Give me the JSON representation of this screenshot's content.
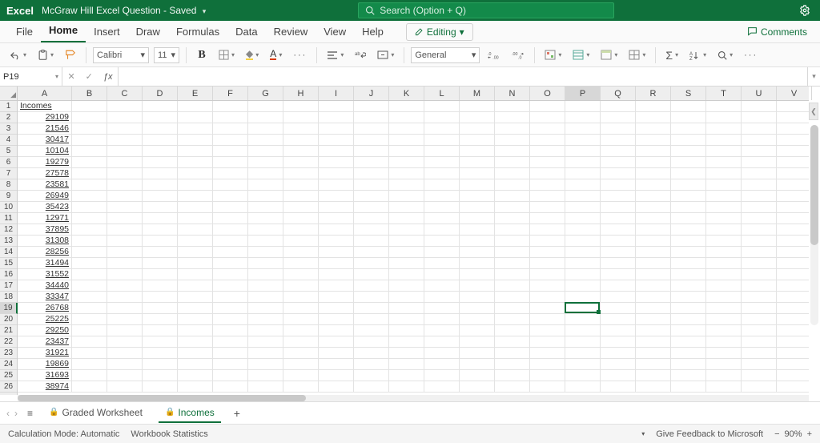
{
  "title": {
    "app": "Excel",
    "doc": "McGraw Hill Excel Question - Saved"
  },
  "search": {
    "placeholder": "Search (Option + Q)"
  },
  "ribbon": {
    "tabs": [
      "File",
      "Home",
      "Insert",
      "Draw",
      "Formulas",
      "Data",
      "Review",
      "View",
      "Help"
    ],
    "active_index": 1,
    "editing_label": "Editing",
    "comments_label": "Comments"
  },
  "toolbar": {
    "font_name": "Calibri",
    "font_size": "11",
    "bold_glyph": "B",
    "number_format": "General",
    "ellipsis": "···"
  },
  "formula_bar": {
    "name_box": "P19",
    "formula": ""
  },
  "columns": [
    "A",
    "B",
    "C",
    "D",
    "E",
    "F",
    "G",
    "H",
    "I",
    "J",
    "K",
    "L",
    "M",
    "N",
    "O",
    "P",
    "Q",
    "R",
    "S",
    "T",
    "U",
    "V"
  ],
  "selected_col_index": 15,
  "row_count": 26,
  "selected_row": 19,
  "colA_header": "Incomes",
  "colA_values": [
    "29109",
    "21546",
    "30417",
    "10104",
    "19279",
    "27578",
    "23581",
    "26949",
    "35423",
    "12971",
    "37895",
    "31308",
    "28256",
    "31494",
    "31552",
    "34440",
    "33347",
    "26768",
    "25225",
    "29250",
    "23437",
    "31921",
    "19869",
    "31693",
    "38974"
  ],
  "sheets": {
    "nav_prev": "‹",
    "nav_next": "›",
    "all": "≡",
    "tabs": [
      {
        "label": "Graded Worksheet",
        "locked": true,
        "active": false
      },
      {
        "label": "Incomes",
        "locked": true,
        "active": true
      }
    ],
    "add": "+"
  },
  "status": {
    "calc_mode": "Calculation Mode: Automatic",
    "workbook_stats": "Workbook Statistics",
    "feedback": "Give Feedback to Microsoft",
    "zoom": "90%",
    "zoom_minus": "−",
    "zoom_plus": "+"
  },
  "chart_data": {
    "type": "table",
    "title": "Incomes",
    "columns": [
      "Incomes"
    ],
    "values": [
      29109,
      21546,
      30417,
      10104,
      19279,
      27578,
      23581,
      26949,
      35423,
      12971,
      37895,
      31308,
      28256,
      31494,
      31552,
      34440,
      33347,
      26768,
      25225,
      29250,
      23437,
      31921,
      19869,
      31693,
      38974
    ]
  }
}
